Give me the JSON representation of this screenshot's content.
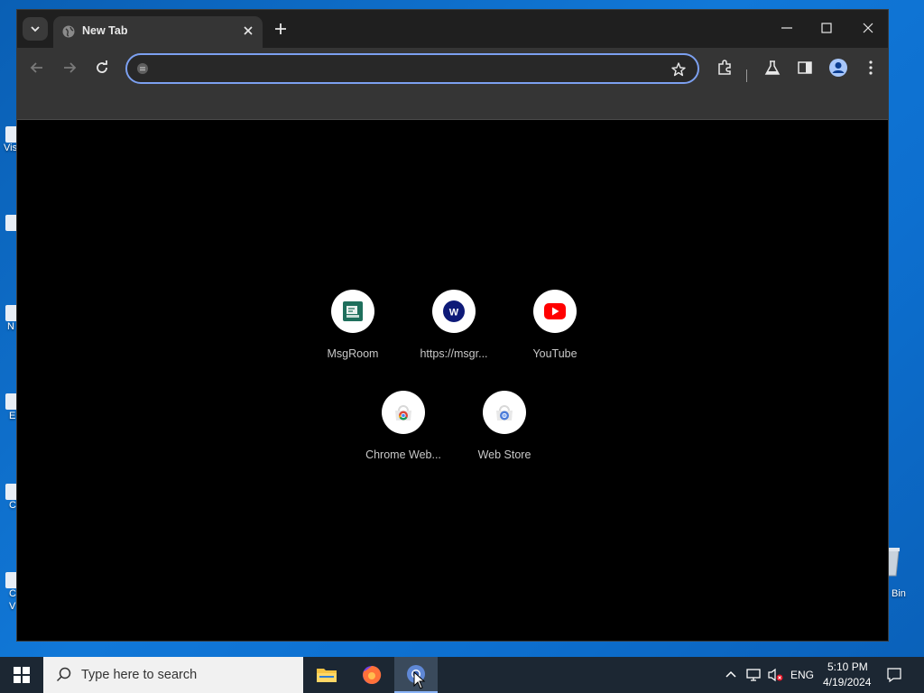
{
  "browser": {
    "tab_title": "New Tab",
    "omnibox_value": "",
    "omnibox_placeholder": ""
  },
  "shortcuts": [
    {
      "label": "MsgRoom",
      "icon": "msgroom-icon"
    },
    {
      "label": "https://msgr...",
      "icon": "w-letter-icon"
    },
    {
      "label": "YouTube",
      "icon": "youtube-icon"
    },
    {
      "label": "Chrome Web...",
      "icon": "chrome-web-store-icon"
    },
    {
      "label": "Web Store",
      "icon": "web-store-icon"
    }
  ],
  "desktop": {
    "recycle_bin_label": "Bin",
    "partial_labels": [
      "Vis",
      "N",
      "E",
      "C",
      "C",
      "V"
    ]
  },
  "taskbar": {
    "search_placeholder": "Type here to search",
    "language": "ENG",
    "time": "5:10 PM",
    "date": "4/19/2024"
  },
  "colors": {
    "accent": "#7ca0f0",
    "tab_bg": "#353535",
    "content_bg": "#000000",
    "desktop_bg": "#1178d8"
  }
}
